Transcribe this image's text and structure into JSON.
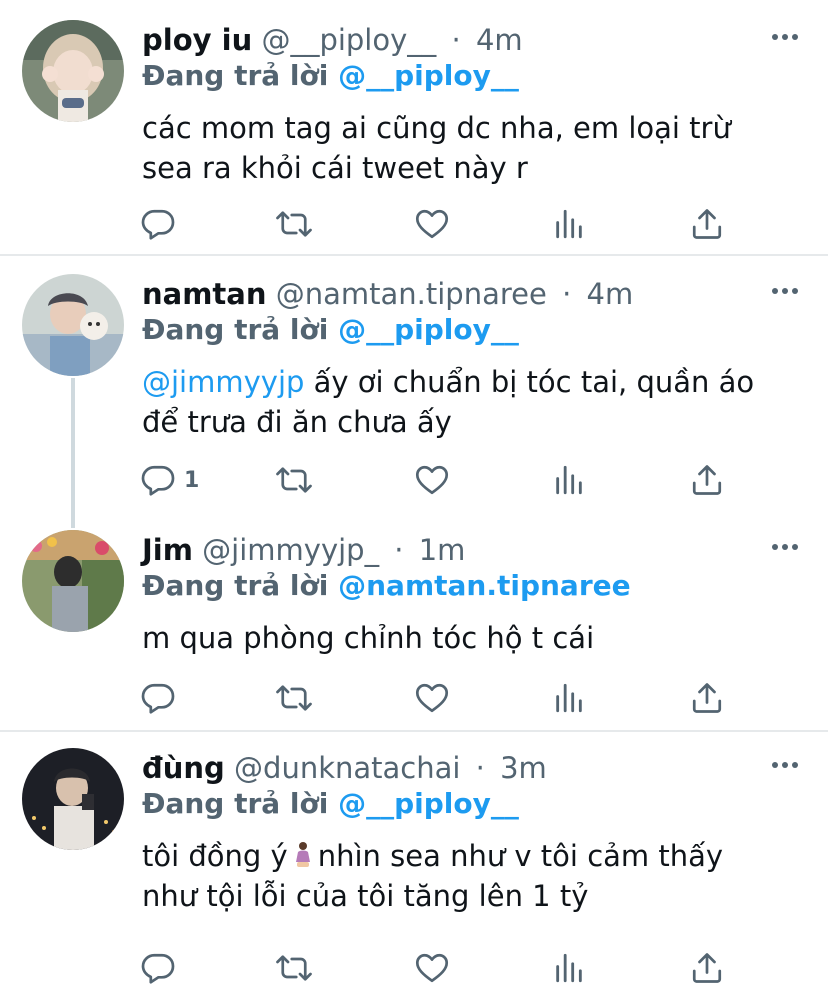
{
  "tweets": [
    {
      "name": "ploy iu",
      "handle": "@__piploy__",
      "separator": "·",
      "time": "4m",
      "replying_prefix": "Đang trả lời",
      "replying_to": "@__piploy__",
      "text_line1": "các mom tag ai cũng dc nha, em loại trừ",
      "text_line2": "sea ra khỏi cái tweet này r",
      "reply_count": ""
    },
    {
      "name": "namtan",
      "handle": "@namtan.tipnaree",
      "separator": "·",
      "time": "4m",
      "replying_prefix": "Đang trả lời",
      "replying_to": "@__piploy__",
      "mention": "@jimmyyjp",
      "text_line1": " ấy ơi chuẩn bị tóc tai, quần áo",
      "text_line2": "để trưa đi ăn chưa ấy",
      "reply_count": "1"
    },
    {
      "name": "Jim",
      "handle": "@jimmyyjp_",
      "separator": "·",
      "time": "1m",
      "replying_prefix": "Đang trả lời",
      "replying_to": "@namtan.tipnaree",
      "text_line1": "m qua phòng chỉnh tóc hộ t cái",
      "reply_count": ""
    },
    {
      "name": "đùng",
      "handle": "@dunknatachai",
      "separator": "·",
      "time": "3m",
      "replying_prefix": "Đang trả lời",
      "replying_to": "@__piploy__",
      "text_line1_a": "tôi đồng ý",
      "text_line1_b": "nhìn sea như v tôi cảm thấy",
      "text_line2": "như tội lỗi của tôi tăng lên 1 tỷ",
      "reply_count": ""
    }
  ],
  "icons": {
    "reply": "reply-icon",
    "retweet": "retweet-icon",
    "like": "heart-icon",
    "views": "views-icon",
    "share": "share-icon",
    "more": "more-icon"
  },
  "colors": {
    "link": "#1d9bf0",
    "secondary": "#536471",
    "text": "#0f1419",
    "divider": "#e6e9eb"
  }
}
